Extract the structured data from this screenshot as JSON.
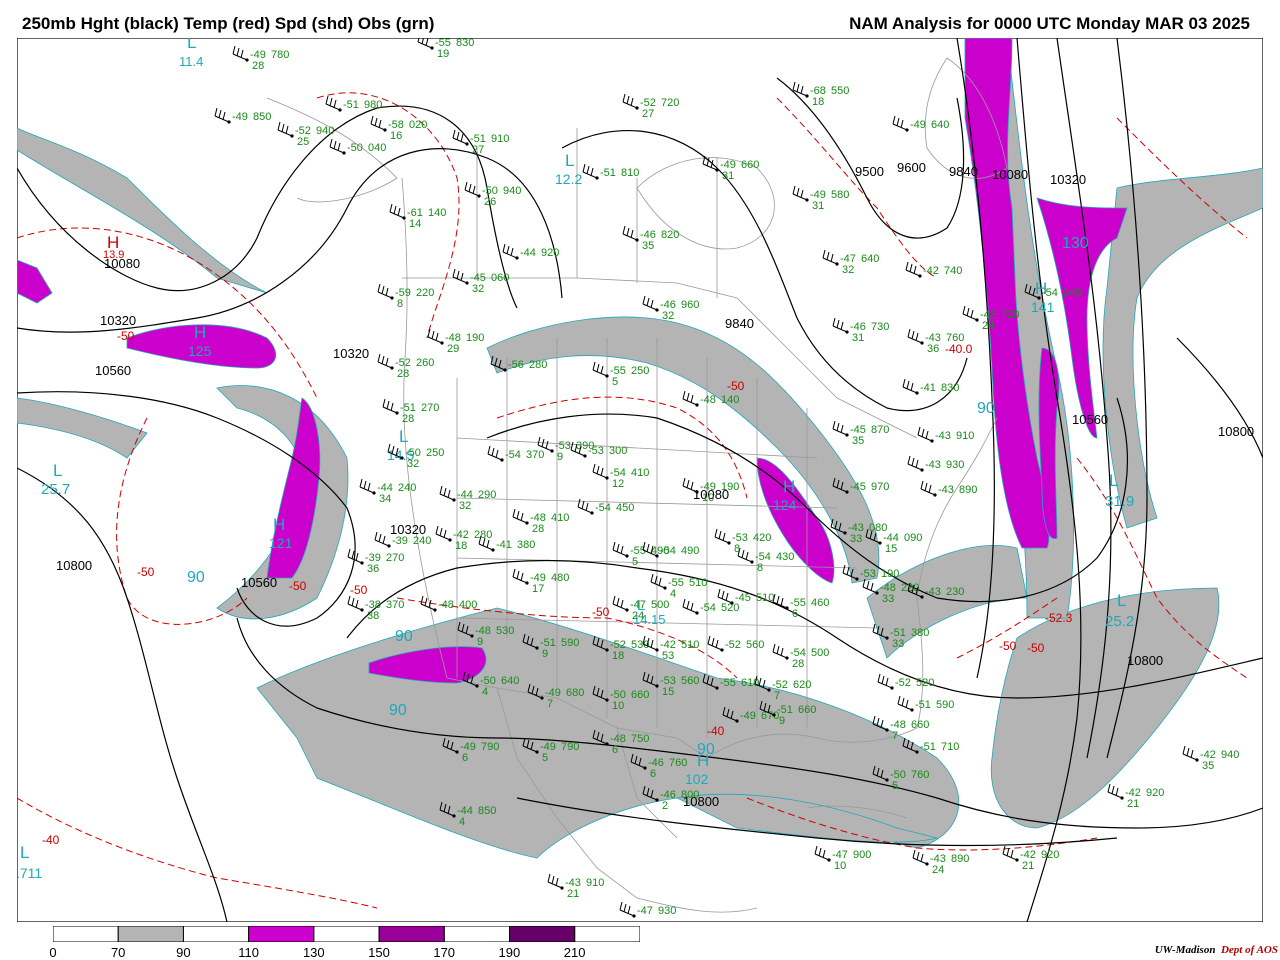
{
  "header": {
    "left_title": "250mb Hght (black) Temp (red) Spd (shd) Obs (grn)",
    "right_title": "NAM Analysis for 0000 UTC Monday  MAR 03 2025"
  },
  "colors": {
    "height": "#000000",
    "temperature": "#cc0000",
    "obs": "#1a8a1a",
    "extrema": "#20a8b8",
    "shade_70_90": "#b4b4b4",
    "shade_110_130": "#cc00cc",
    "shade_150_170": "#990099",
    "shade_190_210": "#660066",
    "borders": "#999999"
  },
  "colorbar": {
    "labels": [
      "0",
      "70",
      "90",
      "110",
      "130",
      "150",
      "170",
      "190",
      "210"
    ],
    "bins": [
      "#ffffff",
      "#b4b4b4",
      "#ffffff",
      "#cc00cc",
      "#ffffff",
      "#990099",
      "#ffffff",
      "#660066",
      "#ffffff"
    ]
  },
  "credit": {
    "org": "UW-Madison",
    "dept": "Dept of AOS"
  },
  "height_labels": [
    "10080",
    "10320",
    "10560",
    "10320",
    "10800",
    "10560",
    "10320",
    "10080",
    "9840",
    "9500",
    "9600",
    "9840",
    "10080",
    "10320",
    "10560",
    "10800",
    "10800",
    "10800"
  ],
  "temp_labels": [
    "-50",
    "-50",
    "-50",
    "-50",
    "-40",
    "-50",
    "-50",
    "-40",
    "-40.0",
    "-52.3",
    "-50",
    "-50"
  ],
  "extrema": [
    {
      "letter": "L",
      "value": "11.4"
    },
    {
      "letter": "H",
      "value": "13.9"
    },
    {
      "letter": "H",
      "value": "125"
    },
    {
      "letter": "H",
      "value": "121"
    },
    {
      "letter": "L",
      "value": "25.7"
    },
    {
      "letter": "L",
      "value": "12.2"
    },
    {
      "letter": "L",
      "value": "14.5"
    },
    {
      "letter": "H",
      "value": "124"
    },
    {
      "letter": "H",
      "value": "141"
    },
    {
      "letter": "L",
      "value": "31.9"
    },
    {
      "letter": "L",
      "value": "25.2"
    },
    {
      "letter": "H",
      "value": "102"
    },
    {
      "letter": "L",
      "value": ".711"
    },
    {
      "letter": "L",
      "value": "14.15"
    }
  ],
  "speed_labels": [
    "90",
    "90",
    "90",
    "90",
    "130",
    "90"
  ],
  "obs": [
    {
      "t": "-49",
      "h": "780",
      "d": "28"
    },
    {
      "t": "-55",
      "h": "830",
      "d": "19"
    },
    {
      "t": "-49",
      "h": "850",
      "d": ""
    },
    {
      "t": "-51",
      "h": "980",
      "d": ""
    },
    {
      "t": "-52",
      "h": "940",
      "d": "25"
    },
    {
      "t": "-58",
      "h": "020",
      "d": "16"
    },
    {
      "t": "-50",
      "h": "040",
      "d": ""
    },
    {
      "t": "-51",
      "h": "910",
      "d": "27"
    },
    {
      "t": "-52",
      "h": "720",
      "d": "27"
    },
    {
      "t": "-68",
      "h": "550",
      "d": "18"
    },
    {
      "t": "-49",
      "h": "640",
      "d": ""
    },
    {
      "t": "-51",
      "h": "810",
      "d": ""
    },
    {
      "t": "-49",
      "h": "660",
      "d": "31"
    },
    {
      "t": "-49",
      "h": "580",
      "d": "31"
    },
    {
      "t": "-50",
      "h": "940",
      "d": "26"
    },
    {
      "t": "-61",
      "h": "140",
      "d": "14"
    },
    {
      "t": "-46",
      "h": "820",
      "d": "35"
    },
    {
      "t": "-47",
      "h": "640",
      "d": "32"
    },
    {
      "t": "-42",
      "h": "740",
      "d": ""
    },
    {
      "t": "-45",
      "h": "060",
      "d": "32"
    },
    {
      "t": "-59",
      "h": "220",
      "d": "8"
    },
    {
      "t": "-46",
      "h": "960",
      "d": "32"
    },
    {
      "t": "-46",
      "h": "730",
      "d": "31"
    },
    {
      "t": "-42",
      "h": "720",
      "d": "24"
    },
    {
      "t": "-48",
      "h": "190",
      "d": "29"
    },
    {
      "t": "-54",
      "h": "240",
      "d": ""
    },
    {
      "t": "-43",
      "h": "760",
      "d": "36"
    },
    {
      "t": "-52",
      "h": "260",
      "d": "28"
    },
    {
      "t": "-56",
      "h": "280",
      "d": ""
    },
    {
      "t": "-55",
      "h": "250",
      "d": "5"
    },
    {
      "t": "-48",
      "h": "140",
      "d": ""
    },
    {
      "t": "-41",
      "h": "830",
      "d": ""
    },
    {
      "t": "-51",
      "h": "270",
      "d": "28"
    },
    {
      "t": "-45",
      "h": "870",
      "d": "35"
    },
    {
      "t": "-43",
      "h": "910",
      "d": ""
    },
    {
      "t": "-50",
      "h": "250",
      "d": "32"
    },
    {
      "t": "-54",
      "h": "370",
      "d": ""
    },
    {
      "t": "-53",
      "h": "390",
      "d": "9"
    },
    {
      "t": "-53",
      "h": "300",
      "d": ""
    },
    {
      "t": "-43",
      "h": "930",
      "d": ""
    },
    {
      "t": "-44",
      "h": "240",
      "d": "34"
    },
    {
      "t": "-54",
      "h": "410",
      "d": "12"
    },
    {
      "t": "-45",
      "h": "970",
      "d": ""
    },
    {
      "t": "-43",
      "h": "890",
      "d": ""
    },
    {
      "t": "-44",
      "h": "290",
      "d": "32"
    },
    {
      "t": "-49",
      "h": "190",
      "d": "10"
    },
    {
      "t": "-54",
      "h": "450",
      "d": ""
    },
    {
      "t": "-48",
      "h": "410",
      "d": "28"
    },
    {
      "t": "-42",
      "h": "280",
      "d": "18"
    },
    {
      "t": "-39",
      "h": "240",
      "d": ""
    },
    {
      "t": "-41",
      "h": "380",
      "d": ""
    },
    {
      "t": "-39",
      "h": "270",
      "d": "36"
    },
    {
      "t": "-55",
      "h": "490",
      "d": "5"
    },
    {
      "t": "-54",
      "h": "490",
      "d": ""
    },
    {
      "t": "-54",
      "h": "430",
      "d": "8"
    },
    {
      "t": "-53",
      "h": "420",
      "d": "8"
    },
    {
      "t": "-43",
      "h": "080",
      "d": "33"
    },
    {
      "t": "-44",
      "h": "090",
      "d": "15"
    },
    {
      "t": "-49",
      "h": "480",
      "d": "17"
    },
    {
      "t": "-55",
      "h": "510",
      "d": "4"
    },
    {
      "t": "-53",
      "h": "190",
      "d": ""
    },
    {
      "t": "-48",
      "h": "220",
      "d": "33"
    },
    {
      "t": "-43",
      "h": "230",
      "d": ""
    },
    {
      "t": "-38",
      "h": "370",
      "d": "38"
    },
    {
      "t": "-48",
      "h": "400",
      "d": ""
    },
    {
      "t": "-47",
      "h": "500",
      "d": "24"
    },
    {
      "t": "-54",
      "h": "520",
      "d": ""
    },
    {
      "t": "-55",
      "h": "460",
      "d": "6"
    },
    {
      "t": "-51",
      "h": "380",
      "d": "33"
    },
    {
      "t": "-48",
      "h": "530",
      "d": "9"
    },
    {
      "t": "-51",
      "h": "590",
      "d": "9"
    },
    {
      "t": "-52",
      "h": "530",
      "d": "18"
    },
    {
      "t": "-42",
      "h": "510",
      "d": "53"
    },
    {
      "t": "-52",
      "h": "560",
      "d": ""
    },
    {
      "t": "-54",
      "h": "500",
      "d": "28"
    },
    {
      "t": "-45",
      "h": "510",
      "d": ""
    },
    {
      "t": "-50",
      "h": "640",
      "d": "4"
    },
    {
      "t": "-53",
      "h": "560",
      "d": "15"
    },
    {
      "t": "-55",
      "h": "610",
      "d": ""
    },
    {
      "t": "-52",
      "h": "620",
      "d": "7"
    },
    {
      "t": "-52",
      "h": "520",
      "d": ""
    },
    {
      "t": "-49",
      "h": "680",
      "d": "7"
    },
    {
      "t": "-50",
      "h": "660",
      "d": "10"
    },
    {
      "t": "-49",
      "h": "670",
      "d": ""
    },
    {
      "t": "-51",
      "h": "660",
      "d": "9"
    },
    {
      "t": "-51",
      "h": "590",
      "d": ""
    },
    {
      "t": "-48",
      "h": "660",
      "d": "7"
    },
    {
      "t": "-49",
      "h": "790",
      "d": "6"
    },
    {
      "t": "-49",
      "h": "790",
      "d": "5"
    },
    {
      "t": "-48",
      "h": "750",
      "d": "6"
    },
    {
      "t": "-46",
      "h": "760",
      "d": "6"
    },
    {
      "t": "-51",
      "h": "710",
      "d": ""
    },
    {
      "t": "-50",
      "h": "760",
      "d": "5"
    },
    {
      "t": "-42",
      "h": "940",
      "d": "35"
    },
    {
      "t": "-44",
      "h": "850",
      "d": "4"
    },
    {
      "t": "-46",
      "h": "800",
      "d": "2"
    },
    {
      "t": "-42",
      "h": "920",
      "d": "21"
    },
    {
      "t": "-47",
      "h": "900",
      "d": "10"
    },
    {
      "t": "-43",
      "h": "890",
      "d": "24"
    },
    {
      "t": "-42",
      "h": "920",
      "d": "21"
    },
    {
      "t": "-43",
      "h": "910",
      "d": "21"
    },
    {
      "t": "-47",
      "h": "930",
      "d": ""
    },
    {
      "t": "-44",
      "h": "920",
      "d": ""
    }
  ]
}
